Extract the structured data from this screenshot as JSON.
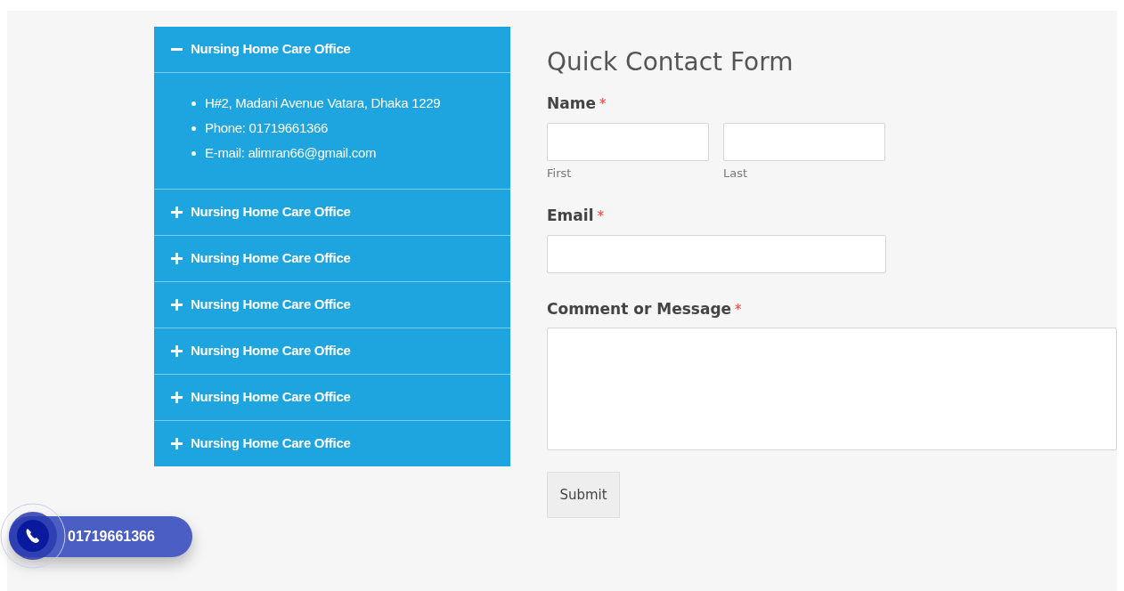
{
  "accordion": [
    {
      "title": "Nursing Home Care Office",
      "expanded": true,
      "details": [
        "H#2, Madani Avenue Vatara, Dhaka 1229",
        "Phone: 01719661366",
        "E-mail: alimran66@gmail.com"
      ]
    },
    {
      "title": "Nursing Home Care Office",
      "expanded": false
    },
    {
      "title": "Nursing Home Care Office",
      "expanded": false
    },
    {
      "title": "Nursing Home Care Office",
      "expanded": false
    },
    {
      "title": "Nursing Home Care Office",
      "expanded": false
    },
    {
      "title": "Nursing Home Care Office",
      "expanded": false
    },
    {
      "title": "Nursing Home Care Office",
      "expanded": false
    }
  ],
  "form": {
    "title": "Quick Contact Form",
    "name": {
      "label": "Name",
      "required_mark": "*",
      "sublabels": [
        "First",
        "Last"
      ]
    },
    "email": {
      "label": "Email",
      "required_mark": "*"
    },
    "message": {
      "label": "Comment or Message",
      "required_mark": "*"
    },
    "submit": "Submit"
  },
  "call_button": {
    "number": "01719661366"
  }
}
